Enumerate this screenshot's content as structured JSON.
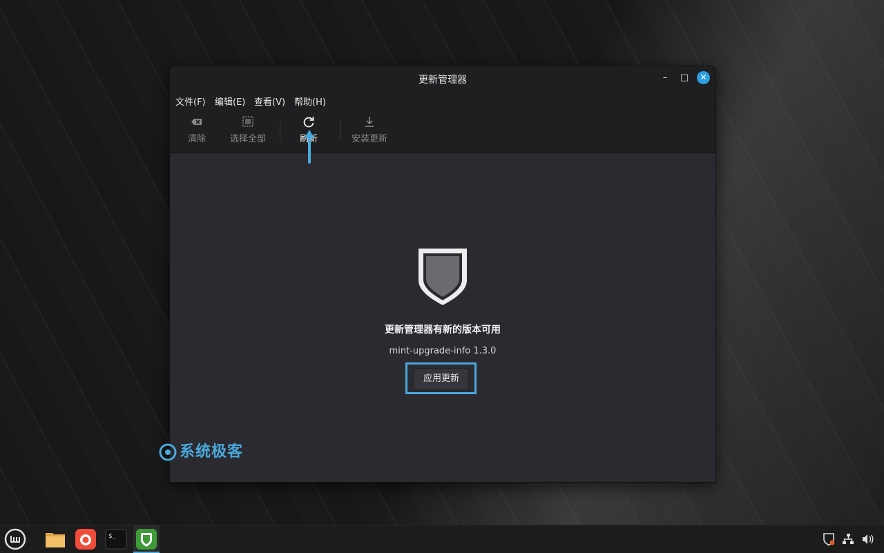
{
  "window": {
    "title": "更新管理器",
    "controls": {
      "minimize": "–",
      "maximize": "□",
      "close": "✕"
    }
  },
  "menu": [
    {
      "label": "文件(F)"
    },
    {
      "label": "编辑(E)"
    },
    {
      "label": "查看(V)"
    },
    {
      "label": "帮助(H)"
    }
  ],
  "toolbar": {
    "clear": {
      "label": "清除",
      "icon": "backspace-icon"
    },
    "select_all": {
      "label": "选择全部",
      "icon": "select-all-icon"
    },
    "refresh": {
      "label": "刷新",
      "icon": "refresh-icon"
    },
    "install": {
      "label": "安装更新",
      "icon": "download-icon"
    }
  },
  "content": {
    "heading": "更新管理器有新的版本可用",
    "package": "mint-upgrade-info 1.3.0",
    "apply_button": "应用更新"
  },
  "watermark": {
    "text": "系统极客"
  },
  "taskbar": {
    "apps": [
      "mint-menu-icon",
      "files-icon",
      "firefox-icon",
      "terminal-icon",
      "update-manager-icon"
    ],
    "tray": [
      "update-shield-icon",
      "network-icon",
      "volume-icon"
    ]
  },
  "colors": {
    "accent": "#4aa9dc",
    "window_bg": "#2a2a30",
    "header_bg": "#1f1f22",
    "close_btn": "#2aa0e0"
  }
}
